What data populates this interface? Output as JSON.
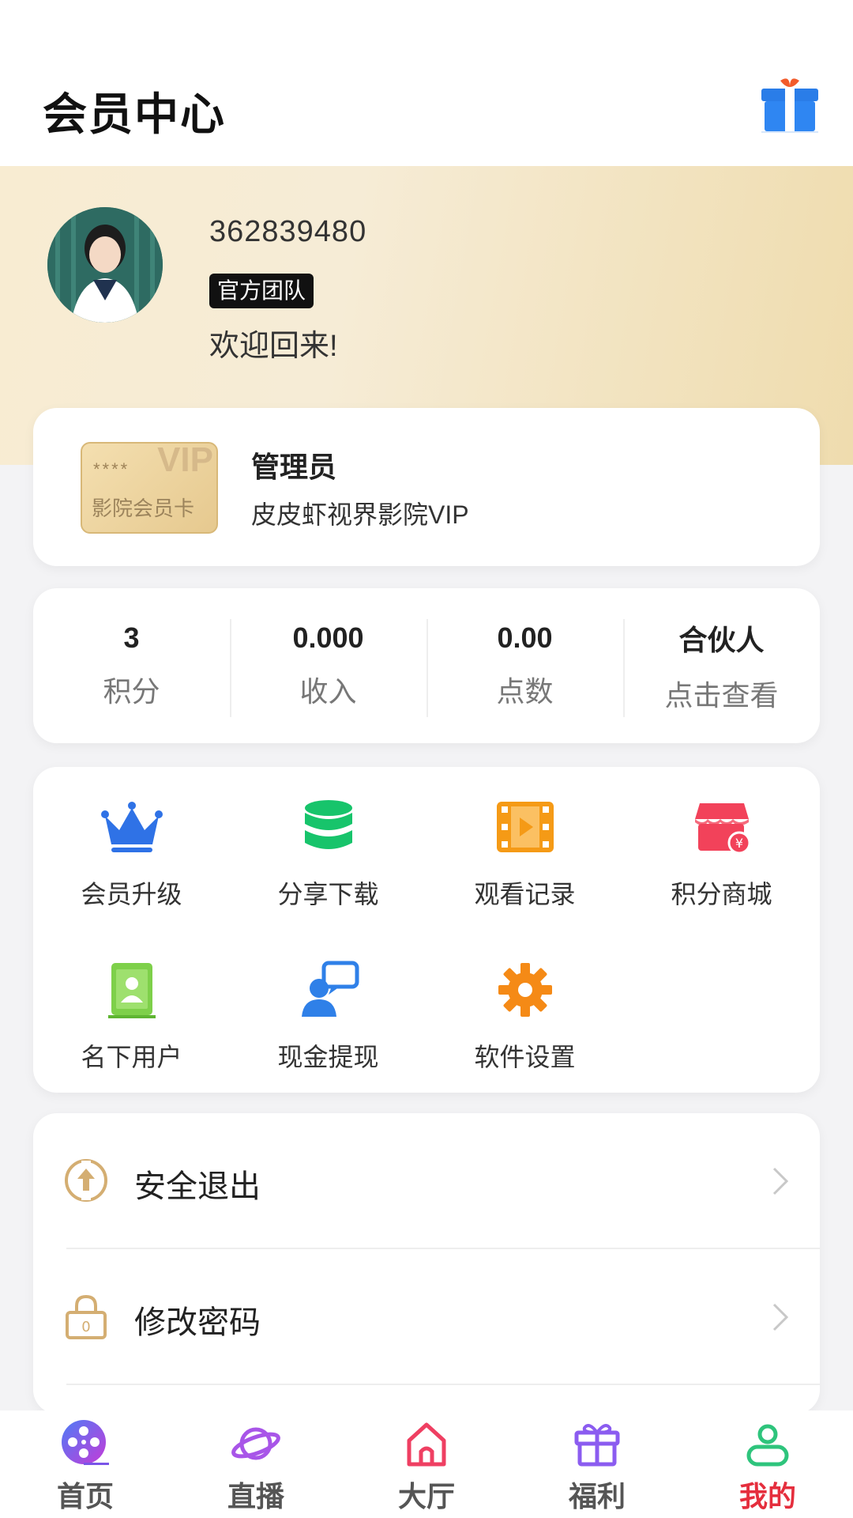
{
  "header": {
    "title": "会员中心",
    "gift_icon": "gift-icon"
  },
  "profile": {
    "user_id": "362839480",
    "badge": "官方团队",
    "welcome": "欢迎回来!"
  },
  "vip": {
    "card_stars": "****",
    "card_word": "VIP",
    "card_caption": "影院会员卡",
    "role": "管理员",
    "description": "皮皮虾视界影院VIP"
  },
  "stats": [
    {
      "value": "3",
      "label": "积分"
    },
    {
      "value": "0.000",
      "label": "收入"
    },
    {
      "value": "0.00",
      "label": "点数"
    },
    {
      "value": "合伙人",
      "label": "点击查看"
    }
  ],
  "grid": [
    {
      "label": "会员升级",
      "icon": "crown-icon",
      "color": "#2f72e6"
    },
    {
      "label": "分享下载",
      "icon": "database-icon",
      "color": "#17c46b"
    },
    {
      "label": "观看记录",
      "icon": "film-icon",
      "color": "#f59a16"
    },
    {
      "label": "积分商城",
      "icon": "shop-icon",
      "color": "#f2425a"
    },
    {
      "label": "名下用户",
      "icon": "contact-book-icon",
      "color": "#7ed04a"
    },
    {
      "label": "现金提现",
      "icon": "user-chat-icon",
      "color": "#2f80e8"
    },
    {
      "label": "软件设置",
      "icon": "gear-icon",
      "color": "#f58a16"
    }
  ],
  "menu": [
    {
      "label": "安全退出",
      "icon": "logout-icon"
    },
    {
      "label": "修改密码",
      "icon": "lock-icon"
    }
  ],
  "tabs": [
    {
      "label": "首页",
      "icon": "film-reel-icon"
    },
    {
      "label": "直播",
      "icon": "planet-icon"
    },
    {
      "label": "大厅",
      "icon": "home-icon"
    },
    {
      "label": "福利",
      "icon": "gift-icon"
    },
    {
      "label": "我的",
      "icon": "user-icon",
      "active": true
    }
  ],
  "colors": {
    "accent": "#e52e3d",
    "banner": "#f3e3bd",
    "gold": "#d4ae72"
  }
}
